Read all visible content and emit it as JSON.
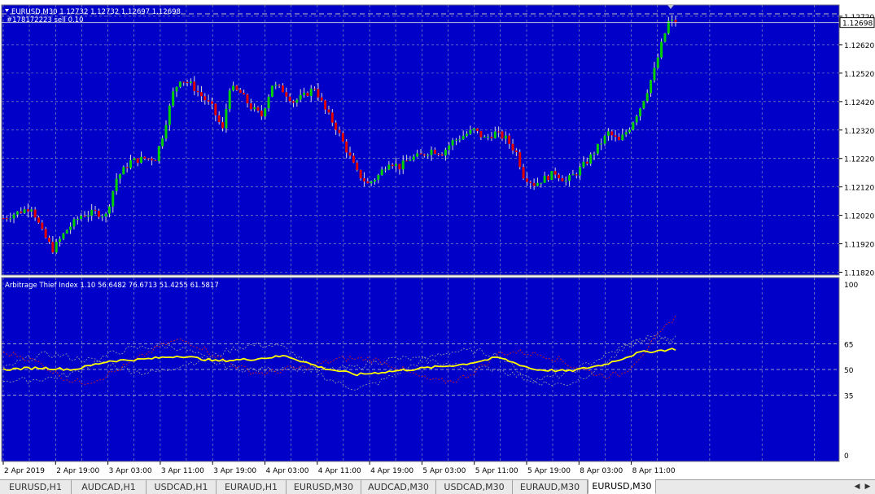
{
  "colors": {
    "background": "#0000c8",
    "grid": "#a0a0b8",
    "bull_candle": "#00d000",
    "bear_candle": "#e00000",
    "wick": "#d8d8d8",
    "axis_text": "#000000",
    "indicator_main": "#ffff00",
    "indicator_red": "#d02020",
    "indicator_gray": "#a0a0a0",
    "label_text": "#ffffff"
  },
  "main_chart": {
    "header": "EURUSD,M30  1.12732 1.12732 1.12697 1.12698",
    "order_line_label": "#178172223 sell 0.10",
    "price_ticks": [
      "1.12720",
      "1.12620",
      "1.12520",
      "1.12420",
      "1.12320",
      "1.12220",
      "1.12120",
      "1.12020",
      "1.11920",
      "1.11820"
    ],
    "current_price_label": "1.12698"
  },
  "indicator": {
    "header": "Arbitrage Thief Index 1.10 56.6482 76.6713 51.4255 61.5817",
    "levels": [
      "100",
      "65",
      "50",
      "35",
      "0"
    ]
  },
  "time_axis": [
    "2 Apr 2019",
    "2 Apr 19:00",
    "3 Apr 03:00",
    "3 Apr 11:00",
    "3 Apr 19:00",
    "4 Apr 03:00",
    "4 Apr 11:00",
    "4 Apr 19:00",
    "5 Apr 03:00",
    "5 Apr 11:00",
    "5 Apr 19:00",
    "8 Apr 03:00",
    "8 Apr 11:00"
  ],
  "chart_data": {
    "type": "candlestick",
    "symbol": "EURUSD",
    "timeframe": "M30",
    "ylim": [
      1.1181,
      1.1276
    ],
    "close_path": [
      [
        0,
        1.1201
      ],
      [
        4,
        1.1203
      ],
      [
        8,
        1.1205
      ],
      [
        11,
        1.1196
      ],
      [
        14,
        1.119
      ],
      [
        18,
        1.1197
      ],
      [
        22,
        1.1202
      ],
      [
        26,
        1.1203
      ],
      [
        29,
        1.1202
      ],
      [
        32,
        1.1215
      ],
      [
        36,
        1.1221
      ],
      [
        40,
        1.1222
      ],
      [
        43,
        1.1222
      ],
      [
        45,
        1.123
      ],
      [
        48,
        1.1245
      ],
      [
        50,
        1.125
      ],
      [
        53,
        1.1248
      ],
      [
        56,
        1.1244
      ],
      [
        59,
        1.124
      ],
      [
        62,
        1.1232
      ],
      [
        64,
        1.1247
      ],
      [
        67,
        1.1245
      ],
      [
        70,
        1.124
      ],
      [
        73,
        1.1237
      ],
      [
        76,
        1.1248
      ],
      [
        79,
        1.1246
      ],
      [
        82,
        1.1242
      ],
      [
        85,
        1.1244
      ],
      [
        88,
        1.1247
      ],
      [
        91,
        1.1239
      ],
      [
        94,
        1.1233
      ],
      [
        97,
        1.1225
      ],
      [
        100,
        1.1217
      ],
      [
        103,
        1.1213
      ],
      [
        106,
        1.1216
      ],
      [
        109,
        1.1221
      ],
      [
        112,
        1.1219
      ],
      [
        115,
        1.1222
      ],
      [
        118,
        1.1223
      ],
      [
        121,
        1.1225
      ],
      [
        124,
        1.1224
      ],
      [
        127,
        1.1228
      ],
      [
        130,
        1.123
      ],
      [
        133,
        1.1232
      ],
      [
        136,
        1.1229
      ],
      [
        139,
        1.1231
      ],
      [
        142,
        1.1229
      ],
      [
        145,
        1.1224
      ],
      [
        147,
        1.1216
      ],
      [
        150,
        1.1213
      ],
      [
        153,
        1.1215
      ],
      [
        156,
        1.1217
      ],
      [
        159,
        1.1214
      ],
      [
        162,
        1.1217
      ],
      [
        165,
        1.1221
      ],
      [
        168,
        1.1226
      ],
      [
        171,
        1.1231
      ],
      [
        174,
        1.1228
      ],
      [
        177,
        1.1233
      ],
      [
        180,
        1.124
      ],
      [
        182,
        1.1246
      ],
      [
        184,
        1.1253
      ],
      [
        186,
        1.1262
      ],
      [
        188,
        1.127
      ],
      [
        190,
        1.127
      ]
    ],
    "indicator_range": [
      0,
      100
    ],
    "indicator_levels": [
      65,
      50,
      35
    ],
    "indicator_path": [
      [
        0,
        50
      ],
      [
        10,
        51
      ],
      [
        20,
        50
      ],
      [
        30,
        55
      ],
      [
        40,
        56
      ],
      [
        50,
        58
      ],
      [
        60,
        55
      ],
      [
        70,
        56
      ],
      [
        80,
        58
      ],
      [
        90,
        51
      ],
      [
        100,
        47
      ],
      [
        110,
        49
      ],
      [
        120,
        51
      ],
      [
        130,
        53
      ],
      [
        140,
        57
      ],
      [
        150,
        50
      ],
      [
        160,
        49
      ],
      [
        170,
        53
      ],
      [
        180,
        60
      ],
      [
        190,
        62
      ]
    ]
  },
  "tabs": [
    "EURUSD,H1",
    "AUDCAD,H1",
    "USDCAD,H1",
    "EURAUD,H1",
    "EURUSD,M30",
    "AUDCAD,M30",
    "USDCAD,M30",
    "EURAUD,M30",
    "EURUSD,M30"
  ],
  "active_tab_index": 8
}
